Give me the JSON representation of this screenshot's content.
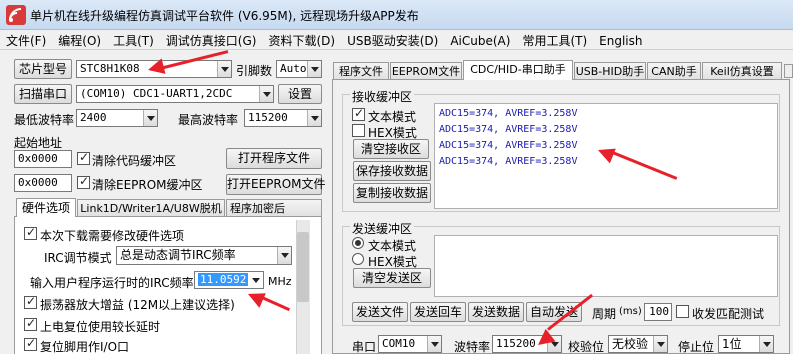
{
  "window": {
    "title": "单片机在线升级编程仿真调试平台软件 (V6.95M), 远程现场升级APP发布"
  },
  "menu": [
    "文件(F)",
    "编程(O)",
    "工具(T)",
    "调试仿真接口(G)",
    "资料下载(D)",
    "USB驱动安装(D)",
    "AiCube(A)",
    "常用工具(T)",
    "English"
  ],
  "left": {
    "chip_button": "芯片型号",
    "chip_value": "STC8H1K08",
    "pin_label": "引脚数",
    "pin_value": "Auto",
    "scan_button": "扫描串口",
    "port_value": "(COM10) CDC1-UART1,2CDC",
    "settings_button": "设置",
    "min_baud_label": "最低波特率",
    "min_baud_value": "2400",
    "max_baud_label": "最高波特率",
    "max_baud_value": "115200",
    "start_addr_label": "起始地址",
    "addr1": "0x0000",
    "clear_code": "清除代码缓冲区",
    "open_prog": "打开程序文件",
    "addr2": "0x0000",
    "clear_eeprom": "清除EEPROM缓冲区",
    "open_eeprom": "打开EEPROM文件",
    "tabs": [
      "硬件选项",
      "Link1D/Writer1A/U8W脱机",
      "程序加密后"
    ],
    "opt_modify": "本次下载需要修改硬件选项",
    "irc_mode_label": "IRC调节模式",
    "irc_mode_value": "总是动态调节IRC频率",
    "irc_freq_label": "输入用户程序运行时的IRC频率",
    "irc_freq_value": "11.0592",
    "irc_unit": "MHz",
    "osc_gain": "振荡器放大增益 (12M以上建议选择)",
    "reset_delay": "上电复位使用较长延时",
    "reset_pin": "复位脚用作I/O口"
  },
  "right": {
    "tabs": [
      "程序文件",
      "EEPROM文件",
      "CDC/HID-串口助手",
      "USB-HID助手",
      "CAN助手",
      "Keil仿真设置"
    ],
    "recv_group": "接收缓冲区",
    "recv_text": "文本模式",
    "recv_hex": "HEX模式",
    "clear_recv": "清空接收区",
    "save_recv": "保存接收数据",
    "copy_recv": "复制接收数据",
    "recv_lines": [
      "ADC15=374,  AVREF=3.258V",
      "ADC15=374,  AVREF=3.258V",
      "ADC15=374,  AVREF=3.258V",
      "ADC15=374,  AVREF=3.258V"
    ],
    "send_group": "发送缓冲区",
    "send_text": "文本模式",
    "send_hex": "HEX模式",
    "clear_send": "清空发送区",
    "send_file": "发送文件",
    "send_enter": "发送回车",
    "send_data": "发送数据",
    "auto_send": "自动发送",
    "period_label": "周期",
    "period_unit": "(ms)",
    "period_value": "100",
    "match_test": "收发匹配测试",
    "port_label": "串口",
    "port_value": "COM10",
    "baud_label": "波特率",
    "baud_value": "115200",
    "parity_label": "校验位",
    "parity_value": "无校验",
    "stop_label": "停止位",
    "stop_value": "1位"
  },
  "colors": {
    "arrow": "#e8202a",
    "recv_text": "#1a1ab0",
    "highlight": "#3399ff"
  }
}
